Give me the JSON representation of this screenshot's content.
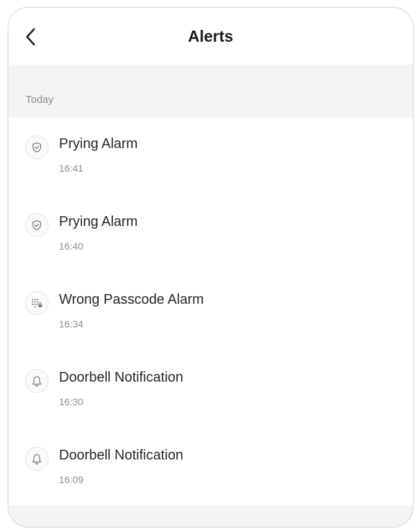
{
  "header": {
    "title": "Alerts",
    "back_icon": "chevron-left-icon"
  },
  "section": {
    "label": "Today"
  },
  "alerts": [
    {
      "title": "Prying Alarm",
      "time": "16:41",
      "icon": "shield-check-icon"
    },
    {
      "title": "Prying Alarm",
      "time": "16:40",
      "icon": "shield-check-icon"
    },
    {
      "title": "Wrong Passcode Alarm",
      "time": "16:34",
      "icon": "keypad-lock-icon"
    },
    {
      "title": "Doorbell Notification",
      "time": "16:30",
      "icon": "bell-icon"
    },
    {
      "title": "Doorbell Notification",
      "time": "16:09",
      "icon": "bell-icon"
    }
  ],
  "colors": {
    "page_background": "#f4f4f4",
    "card_background": "#ffffff",
    "primary_text": "#262626",
    "secondary_text": "#8d8d8d"
  }
}
